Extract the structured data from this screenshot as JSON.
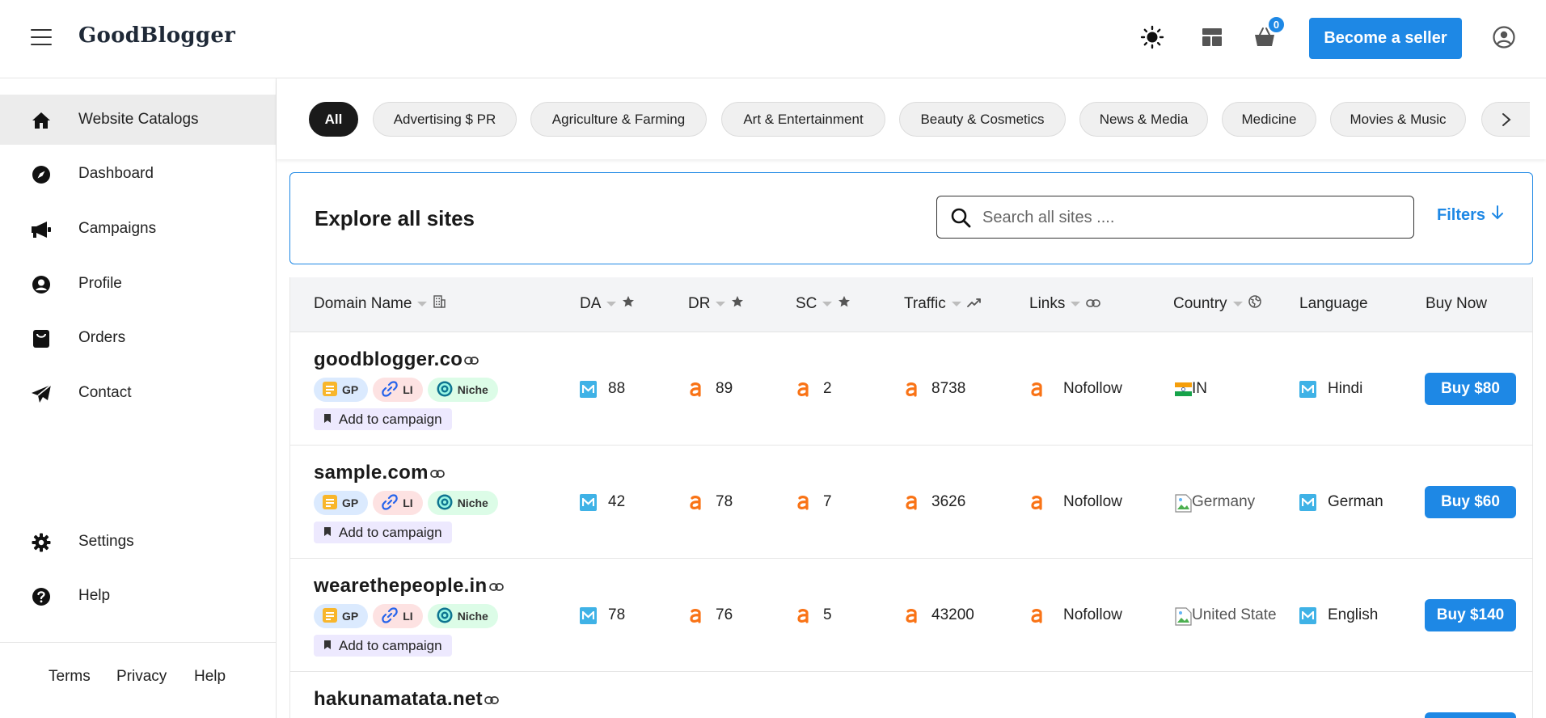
{
  "header": {
    "logo": "GoodBlogger",
    "cart_count": "0",
    "seller_button": "Become a seller"
  },
  "sidebar": {
    "items": [
      {
        "label": "Website Catalogs",
        "icon": "home-icon",
        "active": true
      },
      {
        "label": "Dashboard",
        "icon": "compass-icon"
      },
      {
        "label": "Campaigns",
        "icon": "megaphone-icon"
      },
      {
        "label": "Profile",
        "icon": "user-circle-icon"
      },
      {
        "label": "Orders",
        "icon": "shopping-bag-icon"
      },
      {
        "label": "Contact",
        "icon": "paper-plane-icon"
      }
    ],
    "bottom_items": [
      {
        "label": "Settings",
        "icon": "gear-icon"
      },
      {
        "label": "Help",
        "icon": "question-circle-icon"
      }
    ],
    "footer": {
      "terms": "Terms",
      "privacy": "Privacy",
      "help": "Help"
    }
  },
  "categories": [
    "All",
    "Advertising $ PR",
    "Agriculture & Farming",
    "Art & Entertainment",
    "Beauty & Cosmetics",
    "News & Media",
    "Medicine",
    "Movies & Music"
  ],
  "explore": {
    "title": "Explore all sites",
    "search_placeholder": "Search all sites ....",
    "filters_label": "Filters"
  },
  "table": {
    "columns": {
      "domain": "Domain Name",
      "da": "DA",
      "dr": "DR",
      "sc": "SC",
      "traffic": "Traffic",
      "links": "Links",
      "country": "Country",
      "language": "Language",
      "buy": "Buy Now"
    },
    "tag_labels": {
      "gp": "GP",
      "li": "LI",
      "niche": "Niche"
    },
    "campaign_label": "Add to campaign",
    "rows": [
      {
        "domain": "goodblogger.co",
        "da": "88",
        "dr": "89",
        "sc": "2",
        "traffic": "8738",
        "links": "Nofollow",
        "country": "IN",
        "language": "Hindi",
        "buy": "Buy $80"
      },
      {
        "domain": "sample.com",
        "da": "42",
        "dr": "78",
        "sc": "7",
        "traffic": "3626",
        "links": "Nofollow",
        "country": "Germany",
        "language": "German",
        "buy": "Buy $60"
      },
      {
        "domain": "wearethepeople.in",
        "da": "78",
        "dr": "76",
        "sc": "5",
        "traffic": "43200",
        "links": "Nofollow",
        "country": "United State",
        "language": "English",
        "buy": "Buy $140"
      },
      {
        "domain": "hakunamatata.net"
      }
    ]
  },
  "colors": {
    "accent": "#1e88e5",
    "ahrefs_orange": "#f97316",
    "moz_blue": "#3fb2e6"
  }
}
